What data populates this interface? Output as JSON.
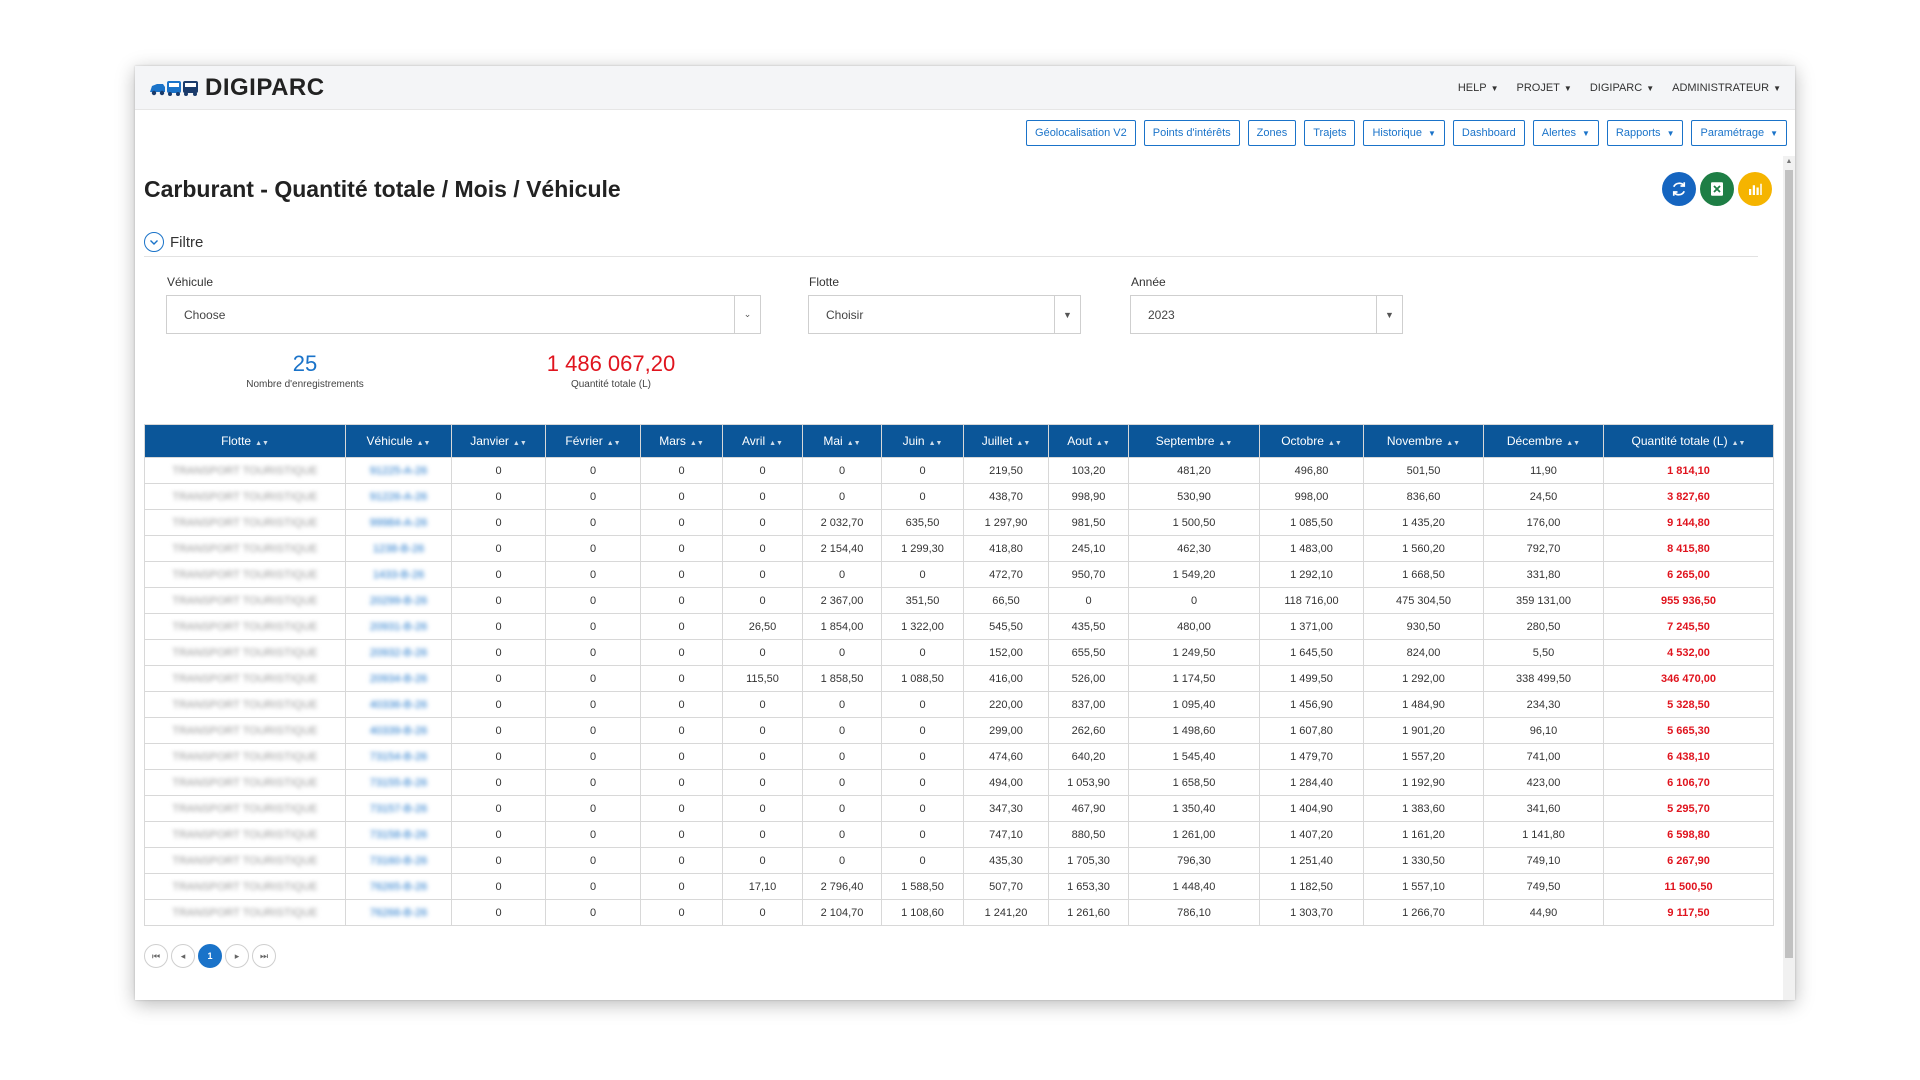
{
  "app": {
    "name": "DIGIPARC"
  },
  "topmenu": [
    {
      "label": "HELP"
    },
    {
      "label": "PROJET"
    },
    {
      "label": "DIGIPARC"
    },
    {
      "label": "ADMINISTRATEUR"
    }
  ],
  "navbuttons": [
    {
      "label": "Géolocalisation V2",
      "dropdown": false
    },
    {
      "label": "Points d'intérêts",
      "dropdown": false
    },
    {
      "label": "Zones",
      "dropdown": false
    },
    {
      "label": "Trajets",
      "dropdown": false
    },
    {
      "label": "Historique",
      "dropdown": true
    },
    {
      "label": "Dashboard",
      "dropdown": false
    },
    {
      "label": "Alertes",
      "dropdown": true
    },
    {
      "label": "Rapports",
      "dropdown": true
    },
    {
      "label": "Paramétrage",
      "dropdown": true
    }
  ],
  "page": {
    "title": "Carburant - Quantité totale / Mois / Véhicule"
  },
  "actions": {
    "refresh_color": "#1565c0",
    "excel_color": "#1e7e45",
    "chart_color": "#f5b400"
  },
  "filter": {
    "label": "Filtre",
    "vehicule": {
      "label": "Véhicule",
      "value": "Choose"
    },
    "flotte": {
      "label": "Flotte",
      "value": "Choisir"
    },
    "annee": {
      "label": "Année",
      "value": "2023"
    }
  },
  "stats": {
    "count_value": "25",
    "count_label": "Nombre d'enregistrements",
    "total_value": "1 486 067,20",
    "total_label": "Quantité totale (L)"
  },
  "colors": {
    "accent": "#1a73c9",
    "header": "#0b5699",
    "total": "#e0141e"
  },
  "table": {
    "columns": [
      "Flotte",
      "Véhicule",
      "Janvier",
      "Février",
      "Mars",
      "Avril",
      "Mai",
      "Juin",
      "Juillet",
      "Aout",
      "Septembre",
      "Octobre",
      "Novembre",
      "Décembre",
      "Quantité totale (L)"
    ],
    "rows": [
      [
        "TRANSPORT TOURISTIQUE",
        "91225-A-26",
        "0",
        "0",
        "0",
        "0",
        "0",
        "0",
        "219,50",
        "103,20",
        "481,20",
        "496,80",
        "501,50",
        "11,90",
        "1 814,10"
      ],
      [
        "TRANSPORT TOURISTIQUE",
        "91226-A-26",
        "0",
        "0",
        "0",
        "0",
        "0",
        "0",
        "438,70",
        "998,90",
        "530,90",
        "998,00",
        "836,60",
        "24,50",
        "3 827,60"
      ],
      [
        "TRANSPORT TOURISTIQUE",
        "99984-A-26",
        "0",
        "0",
        "0",
        "0",
        "2 032,70",
        "635,50",
        "1 297,90",
        "981,50",
        "1 500,50",
        "1 085,50",
        "1 435,20",
        "176,00",
        "9 144,80"
      ],
      [
        "TRANSPORT TOURISTIQUE",
        "1238-B-26",
        "0",
        "0",
        "0",
        "0",
        "2 154,40",
        "1 299,30",
        "418,80",
        "245,10",
        "462,30",
        "1 483,00",
        "1 560,20",
        "792,70",
        "8 415,80"
      ],
      [
        "TRANSPORT TOURISTIQUE",
        "1433-B-26",
        "0",
        "0",
        "0",
        "0",
        "0",
        "0",
        "472,70",
        "950,70",
        "1 549,20",
        "1 292,10",
        "1 668,50",
        "331,80",
        "6 265,00"
      ],
      [
        "TRANSPORT TOURISTIQUE",
        "20299-B-26",
        "0",
        "0",
        "0",
        "0",
        "2 367,00",
        "351,50",
        "66,50",
        "0",
        "0",
        "118 716,00",
        "475 304,50",
        "359 131,00",
        "955 936,50"
      ],
      [
        "TRANSPORT TOURISTIQUE",
        "20931-B-26",
        "0",
        "0",
        "0",
        "26,50",
        "1 854,00",
        "1 322,00",
        "545,50",
        "435,50",
        "480,00",
        "1 371,00",
        "930,50",
        "280,50",
        "7 245,50"
      ],
      [
        "TRANSPORT TOURISTIQUE",
        "20932-B-26",
        "0",
        "0",
        "0",
        "0",
        "0",
        "0",
        "152,00",
        "655,50",
        "1 249,50",
        "1 645,50",
        "824,00",
        "5,50",
        "4 532,00"
      ],
      [
        "TRANSPORT TOURISTIQUE",
        "20934-B-26",
        "0",
        "0",
        "0",
        "115,50",
        "1 858,50",
        "1 088,50",
        "416,00",
        "526,00",
        "1 174,50",
        "1 499,50",
        "1 292,00",
        "338 499,50",
        "346 470,00"
      ],
      [
        "TRANSPORT TOURISTIQUE",
        "40336-B-26",
        "0",
        "0",
        "0",
        "0",
        "0",
        "0",
        "220,00",
        "837,00",
        "1 095,40",
        "1 456,90",
        "1 484,90",
        "234,30",
        "5 328,50"
      ],
      [
        "TRANSPORT TOURISTIQUE",
        "40339-B-26",
        "0",
        "0",
        "0",
        "0",
        "0",
        "0",
        "299,00",
        "262,60",
        "1 498,60",
        "1 607,80",
        "1 901,20",
        "96,10",
        "5 665,30"
      ],
      [
        "TRANSPORT TOURISTIQUE",
        "73154-B-26",
        "0",
        "0",
        "0",
        "0",
        "0",
        "0",
        "474,60",
        "640,20",
        "1 545,40",
        "1 479,70",
        "1 557,20",
        "741,00",
        "6 438,10"
      ],
      [
        "TRANSPORT TOURISTIQUE",
        "73155-B-26",
        "0",
        "0",
        "0",
        "0",
        "0",
        "0",
        "494,00",
        "1 053,90",
        "1 658,50",
        "1 284,40",
        "1 192,90",
        "423,00",
        "6 106,70"
      ],
      [
        "TRANSPORT TOURISTIQUE",
        "73157-B-26",
        "0",
        "0",
        "0",
        "0",
        "0",
        "0",
        "347,30",
        "467,90",
        "1 350,40",
        "1 404,90",
        "1 383,60",
        "341,60",
        "5 295,70"
      ],
      [
        "TRANSPORT TOURISTIQUE",
        "73158-B-26",
        "0",
        "0",
        "0",
        "0",
        "0",
        "0",
        "747,10",
        "880,50",
        "1 261,00",
        "1 407,20",
        "1 161,20",
        "1 141,80",
        "6 598,80"
      ],
      [
        "TRANSPORT TOURISTIQUE",
        "73160-B-26",
        "0",
        "0",
        "0",
        "0",
        "0",
        "0",
        "435,30",
        "1 705,30",
        "796,30",
        "1 251,40",
        "1 330,50",
        "749,10",
        "6 267,90"
      ],
      [
        "TRANSPORT TOURISTIQUE",
        "76265-B-26",
        "0",
        "0",
        "0",
        "17,10",
        "2 796,40",
        "1 588,50",
        "507,70",
        "1 653,30",
        "1 448,40",
        "1 182,50",
        "1 557,10",
        "749,50",
        "11 500,50"
      ],
      [
        "TRANSPORT TOURISTIQUE",
        "76266-B-26",
        "0",
        "0",
        "0",
        "0",
        "2 104,70",
        "1 108,60",
        "1 241,20",
        "1 261,60",
        "786,10",
        "1 303,70",
        "1 266,70",
        "44,90",
        "9 117,50"
      ]
    ]
  },
  "pagination": {
    "current": "1"
  }
}
